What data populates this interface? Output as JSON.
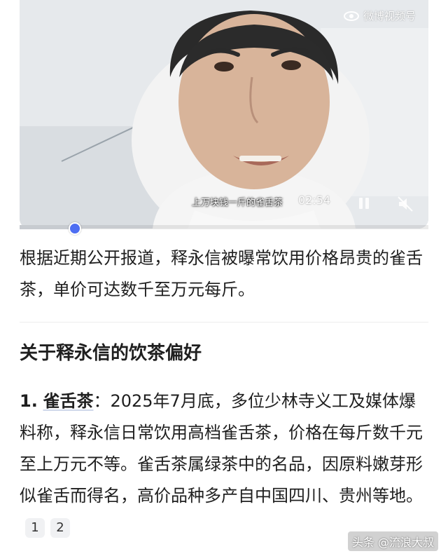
{
  "video": {
    "watermark": "微博视频号",
    "subtitle": "上万块钱一斤的雀舌茶",
    "timecode": "02:54",
    "progress_fraction": 0.15
  },
  "intro": {
    "text": "根据近期公开报道，释永信被曝常饮用价格昂贵的雀舌茶，单价可达数千至万元每斤。"
  },
  "section": {
    "heading": "关于释永信的饮茶偏好",
    "item": {
      "number": "1.",
      "term": "雀舌茶",
      "body": "：2025年7月底，多位少林寺义工及媒体爆料称，释永信日常饮用高档雀舌茶，价格在每斤数千元至上万元不等。雀舌茶属绿茶中的名品，因原料嫩芽形似雀舌而得名，高价品种多产自中国四川、贵州等地。",
      "citations": [
        "1",
        "2"
      ]
    }
  },
  "source": "头条 @流浪大叔"
}
